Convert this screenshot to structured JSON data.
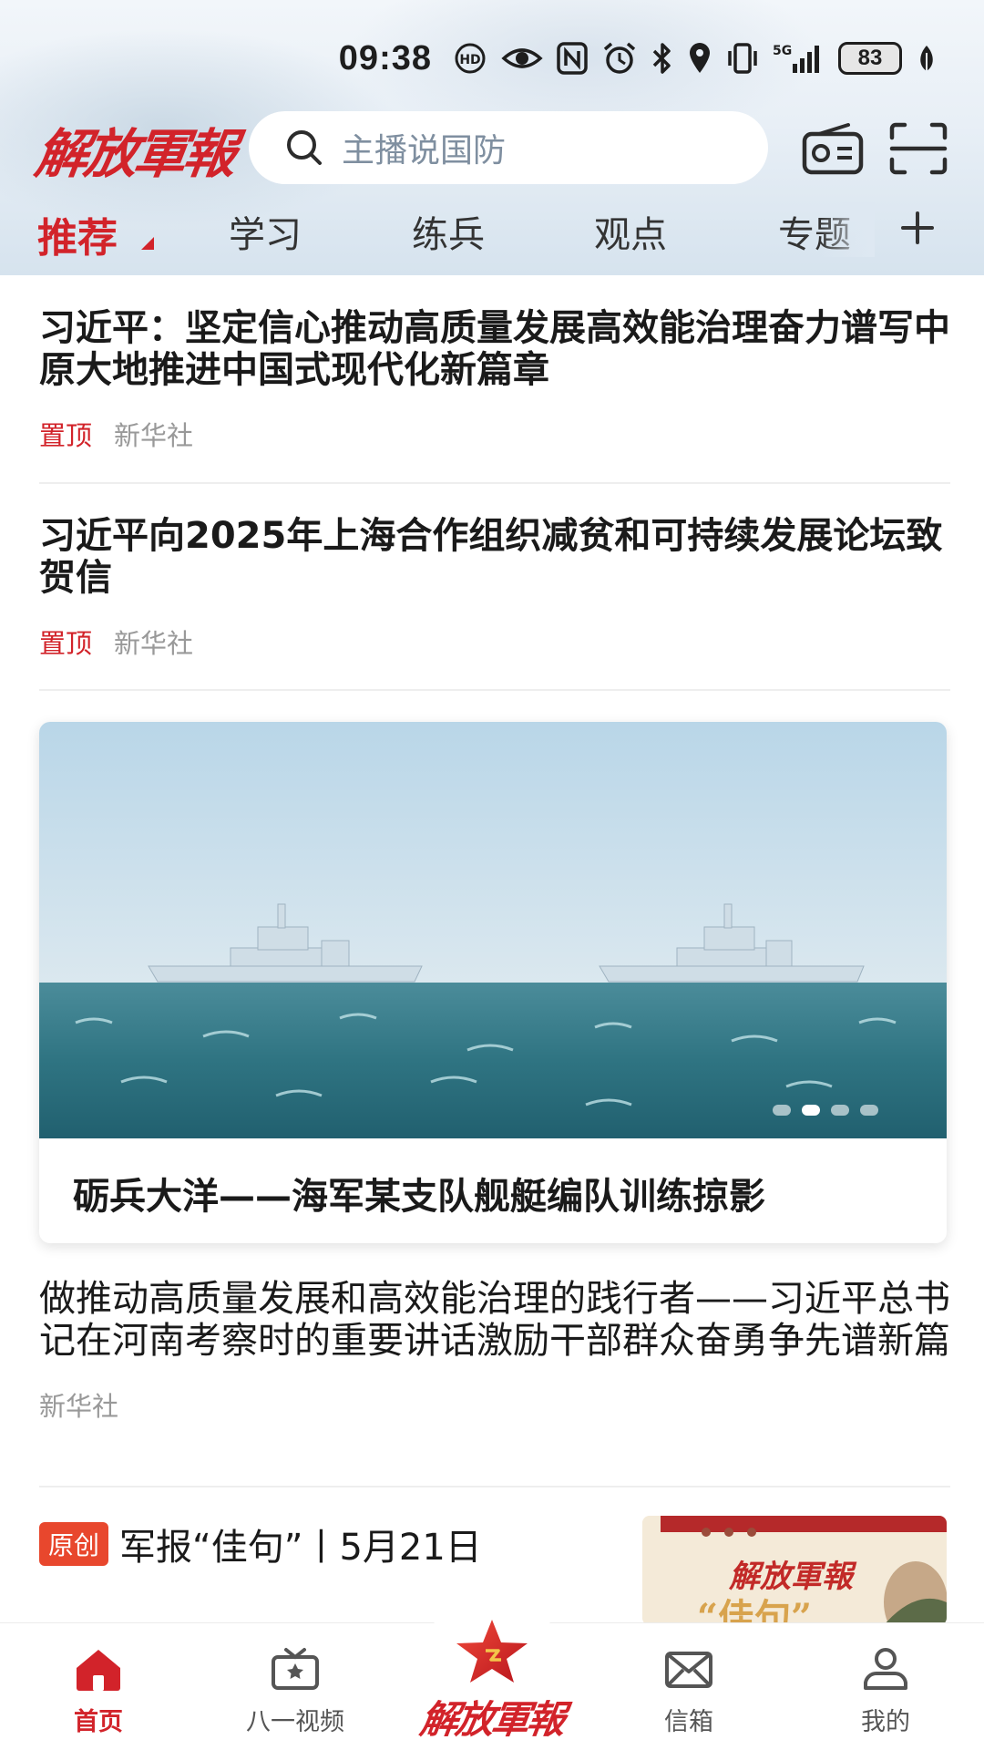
{
  "status_bar": {
    "time": "09:38",
    "battery": "83",
    "network": "5G",
    "icons": [
      "hd-voice-icon",
      "eye-icon",
      "nfc-icon",
      "alarm-icon",
      "bluetooth-icon",
      "location-icon",
      "vibrate-icon",
      "signal-icon",
      "leaf-icon"
    ]
  },
  "header": {
    "logo": "解放軍報",
    "search_placeholder": "主播说国防",
    "radio_icon": "radio-icon",
    "scan_icon": "scan-icon"
  },
  "tabs": [
    {
      "label": "推荐",
      "active": true
    },
    {
      "label": "学习",
      "active": false
    },
    {
      "label": "练兵",
      "active": false
    },
    {
      "label": "观点",
      "active": false
    },
    {
      "label": "专题",
      "active": false
    }
  ],
  "feed": {
    "items": [
      {
        "title": "习近平：坚定信心推动高质量发展高效能治理奋力谱写中原大地推进中国式现代化新篇章",
        "tag": "置顶",
        "source": "新华社"
      },
      {
        "title": "习近平向2025年上海合作组织减贫和可持续发展论坛致贺信",
        "tag": "置顶",
        "source": "新华社"
      }
    ],
    "carousel": {
      "caption": "砺兵大洋——海军某支队舰艇编队训练掠影",
      "slide_count": 4,
      "active_index": 1
    },
    "article": {
      "title": "做推动高质量发展和高效能治理的践行者——习近平总书记在河南考察时的重要讲话激励干部群众奋勇争先谱新篇",
      "source": "新华社"
    },
    "original": {
      "badge": "原创",
      "title": "军报“佳句”丨5月21日",
      "thumb_logo": "解放軍報",
      "thumb_text": "“佳句”"
    }
  },
  "bottom_nav": [
    {
      "label": "首页",
      "icon": "home-icon",
      "active": true
    },
    {
      "label": "八一视频",
      "icon": "tv-icon",
      "active": false
    },
    {
      "label": "解放軍報",
      "icon": "red-star-icon",
      "active": false
    },
    {
      "label": "信箱",
      "icon": "mail-icon",
      "active": false
    },
    {
      "label": "我的",
      "icon": "user-icon",
      "active": false
    }
  ],
  "colors": {
    "brand_red": "#d2232a",
    "badge_orange": "#e8472d",
    "meta_gray": "#999999"
  }
}
